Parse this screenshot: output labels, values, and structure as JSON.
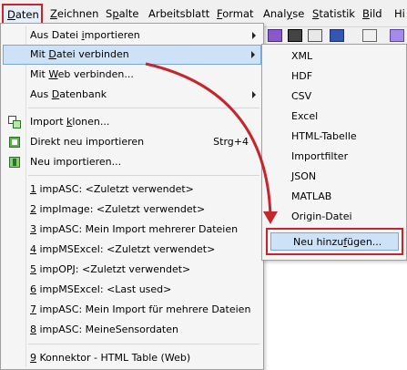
{
  "menubar": {
    "items": [
      {
        "pre": "",
        "u": "D",
        "post": "aten"
      },
      {
        "pre": "",
        "u": "Z",
        "post": "eichnen"
      },
      {
        "pre": "S",
        "u": "p",
        "post": "alte"
      },
      {
        "pre": "Arbeitsblatt",
        "u": "",
        "post": ""
      },
      {
        "pre": "",
        "u": "F",
        "post": "ormat"
      },
      {
        "pre": "Anal",
        "u": "y",
        "post": "se"
      },
      {
        "pre": "",
        "u": "S",
        "post": "tatistik"
      },
      {
        "pre": "",
        "u": "B",
        "post": "ild"
      },
      {
        "pre": "Hi",
        "u": "",
        "post": ""
      }
    ]
  },
  "menu": {
    "import_file": {
      "pre": "Aus Datei ",
      "u": "i",
      "post": "mportieren"
    },
    "connect_file": {
      "pre": "Mit ",
      "u": "D",
      "post": "atei verbinden"
    },
    "connect_web": {
      "pre": "Mit ",
      "u": "W",
      "post": "eb verbinden..."
    },
    "from_db": {
      "pre": "Aus ",
      "u": "D",
      "post": "atenbank"
    },
    "clone_import": {
      "pre": "Import ",
      "u": "k",
      "post": "lonen..."
    },
    "reimport": {
      "pre": "Direkt neu importieren",
      "u": "",
      "post": ""
    },
    "reimport_shortcut": "Strg+4",
    "new_import": {
      "pre": "Neu importieren...",
      "u": "",
      "post": ""
    },
    "recent": [
      {
        "num": "1",
        "text": " impASC: <Zuletzt verwendet>"
      },
      {
        "num": "2",
        "text": " impImage: <Zuletzt verwendet>"
      },
      {
        "num": "3",
        "text": " impASC: Mein Import mehrerer Dateien"
      },
      {
        "num": "4",
        "text": " impMSExcel: <Zuletzt verwendet>"
      },
      {
        "num": "5",
        "text": " impOPJ: <Zuletzt verwendet>"
      },
      {
        "num": "6",
        "text": " impMSExcel: <Last used>"
      },
      {
        "num": "7",
        "text": " impASC: Mein Import für mehrere Dateien"
      },
      {
        "num": "8",
        "text": " impASC: MeineSensordaten"
      }
    ],
    "connector": {
      "num": "9",
      "text": " Konnektor - HTML Table (Web)"
    }
  },
  "submenu": {
    "items": [
      "XML",
      "HDF",
      "CSV",
      "Excel",
      "HTML-Tabelle",
      "Importfilter",
      "JSON",
      "MATLAB",
      "Origin-Datei"
    ],
    "add_new": {
      "pre": "Neu hinzu",
      "u": "f",
      "post": "ügen..."
    }
  },
  "colors": {
    "highlight_box": "#c5262c",
    "arrow": "#c5262c",
    "selection": "#cde1f7"
  }
}
